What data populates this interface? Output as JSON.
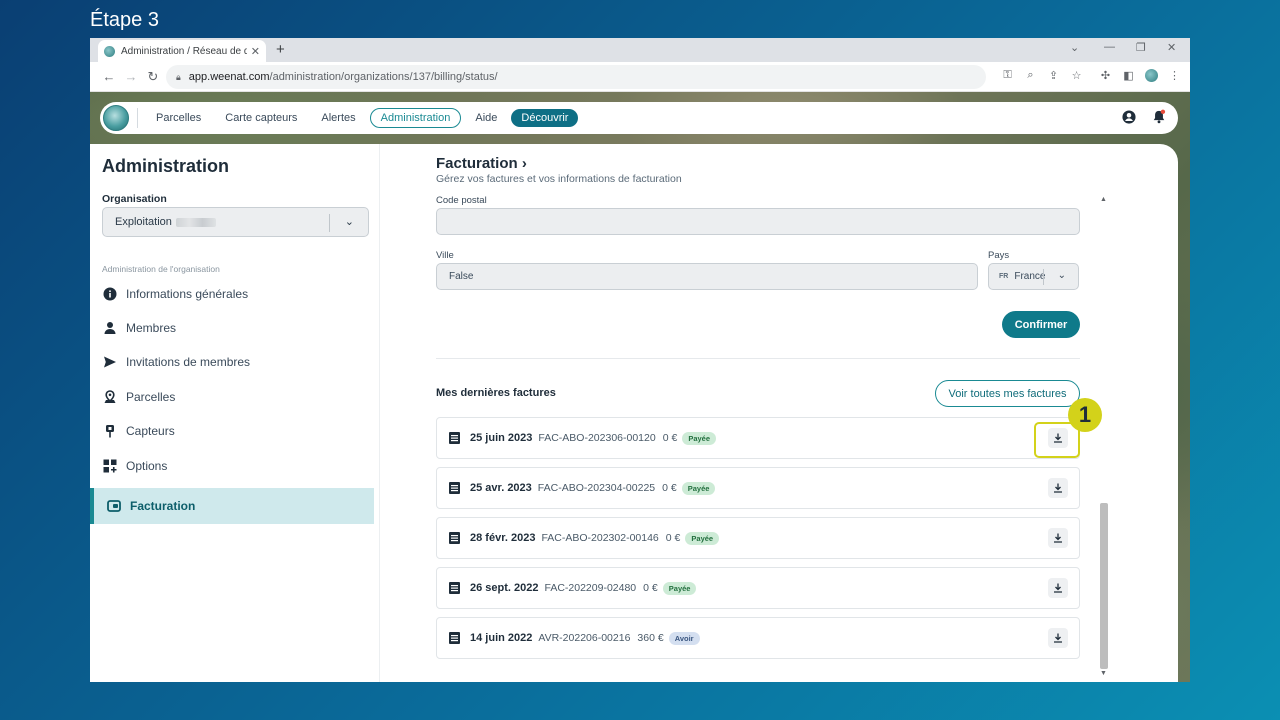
{
  "step_label": "Étape 3",
  "browser": {
    "tab_title": "Administration / Réseau de démo",
    "url_domain": "app.weenat.com",
    "url_path": "/administration/organizations/137/billing/status/"
  },
  "nav": {
    "items": [
      "Parcelles",
      "Carte capteurs",
      "Alertes"
    ],
    "active": "Administration",
    "help": "Aide",
    "discover": "Découvrir"
  },
  "sidebar": {
    "title": "Administration",
    "org_label": "Organisation",
    "org_value": "Exploitation",
    "section_label": "Administration de l'organisation",
    "items": [
      {
        "label": "Informations générales",
        "icon": "info-icon"
      },
      {
        "label": "Membres",
        "icon": "person-icon"
      },
      {
        "label": "Invitations de membres",
        "icon": "send-icon"
      },
      {
        "label": "Parcelles",
        "icon": "map-pin-icon"
      },
      {
        "label": "Capteurs",
        "icon": "sensor-icon"
      },
      {
        "label": "Options",
        "icon": "grid-plus-icon"
      }
    ],
    "active": "Facturation"
  },
  "content": {
    "title": "Facturation",
    "title_chevron": "›",
    "subtitle": "Gérez vos factures et vos informations de facturation",
    "postal_label": "Code postal",
    "postal_value": "",
    "city_label": "Ville",
    "city_value": "False",
    "country_label": "Pays",
    "country_code": "FR",
    "country_value": "France",
    "confirm_label": "Confirmer",
    "invoices_title": "Mes dernières factures",
    "all_invoices_label": "Voir toutes mes factures",
    "invoices": [
      {
        "date": "25 juin 2023",
        "number": "FAC-ABO-202306-00120",
        "amount": "0 €",
        "status": "Payée",
        "kind": "paid"
      },
      {
        "date": "25 avr. 2023",
        "number": "FAC-ABO-202304-00225",
        "amount": "0 €",
        "status": "Payée",
        "kind": "paid"
      },
      {
        "date": "28 févr. 2023",
        "number": "FAC-ABO-202302-00146",
        "amount": "0 €",
        "status": "Payée",
        "kind": "paid"
      },
      {
        "date": "26 sept. 2022",
        "number": "FAC-202209-02480",
        "amount": "0 €",
        "status": "Payée",
        "kind": "paid"
      },
      {
        "date": "14 juin 2022",
        "number": "AVR-202206-00216",
        "amount": "360 €",
        "status": "Avoir",
        "kind": "credit"
      }
    ]
  },
  "annotation": {
    "marker": "1"
  },
  "colors": {
    "accent": "#1a8a93",
    "primary_button": "#0f7a8a",
    "highlight": "#d3d21a"
  }
}
